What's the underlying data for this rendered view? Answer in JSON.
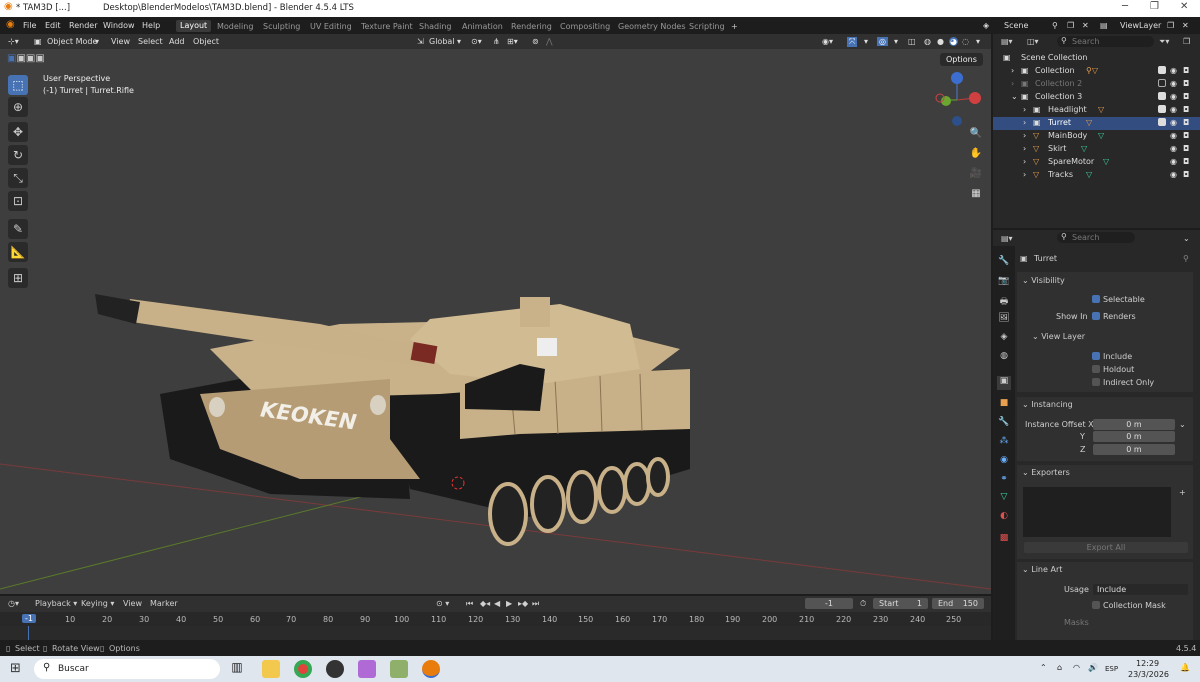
{
  "titlebar": {
    "title": "* TAM3D [...]",
    "path": "Desktop\\BlenderModelos\\TAM3D.blend] - Blender 4.5.4 LTS"
  },
  "menus": [
    "File",
    "Edit",
    "Render",
    "Window",
    "Help"
  ],
  "workspaces": [
    "Layout",
    "Modeling",
    "Sculpting",
    "UV Editing",
    "Texture Paint",
    "Shading",
    "Animation",
    "Rendering",
    "Compositing",
    "Geometry Nodes",
    "Scripting"
  ],
  "topright": {
    "scene": "Scene",
    "view_layer": "ViewLayer"
  },
  "viewport_header": {
    "mode": "Object Mode",
    "view": "View",
    "select": "Select",
    "add": "Add",
    "object": "Object",
    "orientation": "Global",
    "options": "Options"
  },
  "viewport": {
    "perspective": "User Perspective",
    "object_info": "(-1) Turret | Turret.Rifle",
    "tank_text": "KEOKEN"
  },
  "outliner": {
    "search_placeholder": "Search",
    "rows": [
      {
        "label": "Scene Collection"
      },
      {
        "label": "Collection"
      },
      {
        "label": "Collection 2"
      },
      {
        "label": "Collection 3"
      },
      {
        "label": "Headlight"
      },
      {
        "label": "Turret"
      },
      {
        "label": "MainBody"
      },
      {
        "label": "Skirt"
      },
      {
        "label": "SpareMotor"
      },
      {
        "label": "Tracks"
      }
    ]
  },
  "properties": {
    "search_placeholder": "Search",
    "object_name": "Turret",
    "visibility": {
      "title": "Visibility",
      "selectable": "Selectable",
      "show_in": "Show In",
      "renders": "Renders",
      "view_layer": "View Layer",
      "include": "Include",
      "holdout": "Holdout",
      "indirect_only": "Indirect Only"
    },
    "instancing": {
      "title": "Instancing",
      "offset_label": "Instance Offset X",
      "y_label": "Y",
      "z_label": "Z",
      "x": "0 m",
      "y": "0 m",
      "z": "0 m"
    },
    "exporters": {
      "title": "Exporters",
      "export_all": "Export All"
    },
    "line_art": {
      "title": "Line Art",
      "usage_label": "Usage",
      "usage": "Include",
      "collection_mask": "Collection Mask",
      "masks": "Masks"
    }
  },
  "timeline": {
    "playback": "Playback",
    "keying": "Keying",
    "view": "View",
    "marker": "Marker",
    "current_frame": "-1",
    "start_label": "Start",
    "start": "1",
    "end_label": "End",
    "end": "150",
    "ticks": [
      "10",
      "20",
      "30",
      "40",
      "50",
      "60",
      "70",
      "80",
      "90",
      "100",
      "110",
      "120",
      "130",
      "140",
      "150",
      "160",
      "170",
      "180",
      "190",
      "200",
      "210",
      "220",
      "230",
      "240",
      "250"
    ],
    "cursor": "-1"
  },
  "statusbar": {
    "select": "Select",
    "rotate": "Rotate View",
    "options": "Options",
    "version": "4.5.4"
  },
  "taskbar": {
    "search": "Buscar",
    "lang": "ESP",
    "time": "12:29",
    "date": "23/3/2026"
  }
}
